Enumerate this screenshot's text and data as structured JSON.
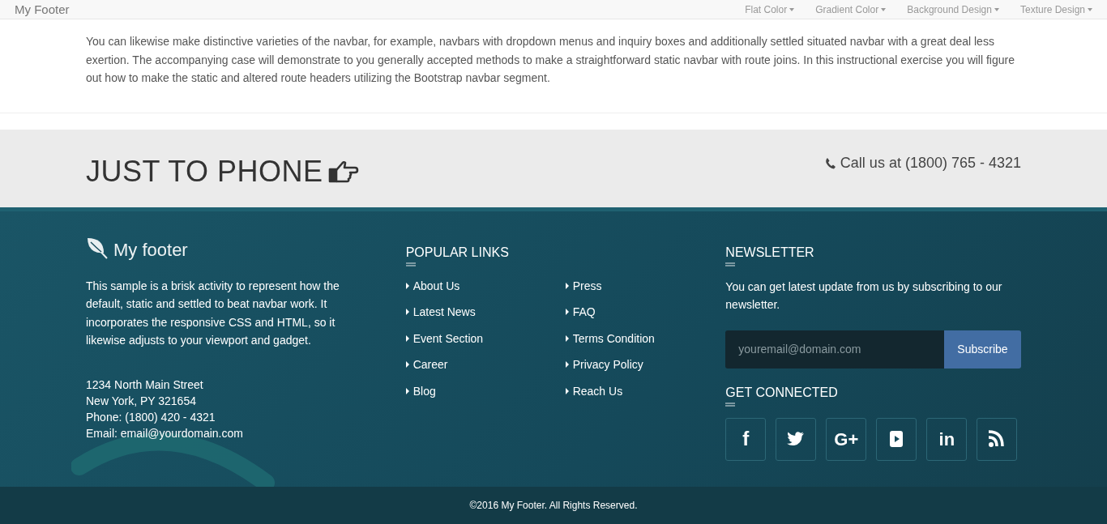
{
  "navbar": {
    "brand": "My Footer",
    "items": [
      {
        "label": "Flat Color"
      },
      {
        "label": "Gradient Color"
      },
      {
        "label": "Background Design"
      },
      {
        "label": "Texture Design"
      }
    ]
  },
  "intro": "You can likewise make distinctive varieties of the navbar, for example, navbars with dropdown menus and inquiry boxes and additionally settled situated navbar with a great deal less exertion. The accompanying case will demonstrate to you generally accepted methods to make a straightforward static navbar with route joins. In this instructional exercise you will figure out how to make the static and altered route headers utilizing the Bootstrap navbar segment.",
  "cta": {
    "heading": "JUST TO PHONE",
    "phone": "Call us at (1800) 765 - 4321"
  },
  "footer": {
    "brand": "My footer",
    "about": "This sample is a brisk activity to represent how the default, static and settled to beat navbar work. It incorporates the responsive CSS and HTML, so it likewise adjusts to your viewport and gadget.",
    "address": [
      "1234 North Main Street",
      "New York, PY 321654",
      "Phone: (1800) 420 - 4321",
      "Email: email@yourdomain.com"
    ],
    "popular_links": {
      "title": "POPULAR LINKS",
      "columns": [
        [
          "About Us",
          "Latest News",
          "Event Section",
          "Career",
          "Blog"
        ],
        [
          "Press",
          "FAQ",
          "Terms Condition",
          "Privacy Policy",
          "Reach Us"
        ]
      ]
    },
    "newsletter": {
      "title": "NEWSLETTER",
      "text": "You can get latest update from us by subscribing to our newsletter.",
      "placeholder": "youremail@domain.com",
      "button": "Subscribe"
    },
    "social": {
      "title": "GET CONNECTED",
      "items": [
        {
          "kind": "facebook",
          "glyph": "f"
        },
        {
          "kind": "twitter"
        },
        {
          "kind": "googleplus",
          "glyph": "G+"
        },
        {
          "kind": "youtube"
        },
        {
          "kind": "linkedin",
          "glyph": "in"
        },
        {
          "kind": "rss"
        }
      ]
    }
  },
  "copyright": "©2016 My Footer. All Rights Reserved."
}
